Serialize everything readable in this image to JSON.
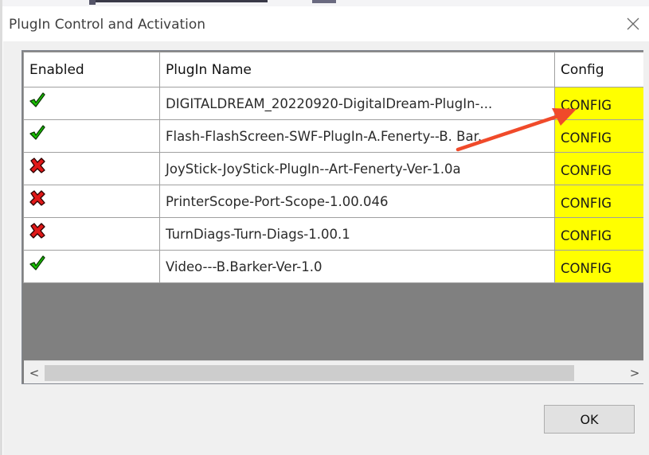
{
  "window": {
    "title": "PlugIn Control and Activation",
    "close_glyph": "✕"
  },
  "table": {
    "headers": {
      "enabled": "Enabled",
      "name": "PlugIn Name",
      "config": "Config"
    },
    "rows": [
      {
        "enabled": true,
        "status_icon": "green-check-icon",
        "name": "DIGITALDREAM_20220920-DigitalDream-PlugIn-...",
        "config": "CONFIG"
      },
      {
        "enabled": true,
        "status_icon": "green-check-icon",
        "name": "Flash-FlashScreen-SWF-PlugIn-A.Fenerty--B. Bar...",
        "config": "CONFIG"
      },
      {
        "enabled": false,
        "status_icon": "red-x-icon",
        "name": "JoyStick-JoyStick-PlugIn--Art-Fenerty-Ver-1.0a",
        "config": "CONFIG"
      },
      {
        "enabled": false,
        "status_icon": "red-x-icon",
        "name": "PrinterScope-Port-Scope-1.00.046",
        "config": "CONFIG"
      },
      {
        "enabled": false,
        "status_icon": "red-x-icon",
        "name": "TurnDiags-Turn-Diags-1.00.1",
        "config": "CONFIG"
      },
      {
        "enabled": true,
        "status_icon": "green-check-icon",
        "name": "Video---B.Barker-Ver-1.0",
        "config": "CONFIG"
      }
    ],
    "config_color": "#ffff00",
    "empty_area_color": "#808080"
  },
  "scrollbar": {
    "left_glyph": "<",
    "right_glyph": ">"
  },
  "ok_button": {
    "label": "OK"
  },
  "annotation": {
    "arrow_color": "#f04a2a"
  }
}
